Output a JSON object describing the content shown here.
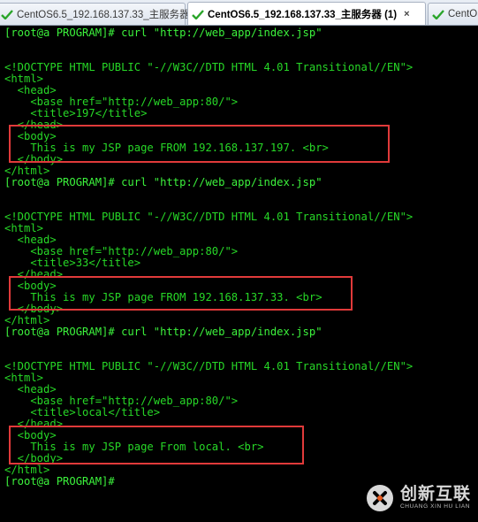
{
  "tabs": [
    {
      "label": "CentOS6.5_192.168.137.33_主服务器",
      "active": false
    },
    {
      "label": "CentOS6.5_192.168.137.33_主服务器 (1)",
      "active": true,
      "close": "×"
    },
    {
      "label": "CentOS",
      "active": false
    }
  ],
  "terminal": {
    "lines": [
      "[root@a PROGRAM]# curl \"http://web_app/index.jsp\"",
      "",
      "",
      "<!DOCTYPE HTML PUBLIC \"-//W3C//DTD HTML 4.01 Transitional//EN\">",
      "<html>",
      "  <head>",
      "    <base href=\"http://web_app:80/\">",
      "    <title>197</title>",
      "  </head>",
      "  <body>",
      "    This is my JSP page FROM 192.168.137.197. <br>",
      "  </body>",
      "</html>",
      "[root@a PROGRAM]# curl \"http://web_app/index.jsp\"",
      "",
      "",
      "<!DOCTYPE HTML PUBLIC \"-//W3C//DTD HTML 4.01 Transitional//EN\">",
      "<html>",
      "  <head>",
      "    <base href=\"http://web_app:80/\">",
      "    <title>33</title>",
      "  </head>",
      "  <body>",
      "    This is my JSP page FROM 192.168.137.33. <br>",
      "  </body>",
      "</html>",
      "[root@a PROGRAM]# curl \"http://web_app/index.jsp\"",
      "",
      "",
      "<!DOCTYPE HTML PUBLIC \"-//W3C//DTD HTML 4.01 Transitional//EN\">",
      "<html>",
      "  <head>",
      "    <base href=\"http://web_app:80/\">",
      "    <title>local</title>",
      "  </head>",
      "  <body>",
      "    This is my JSP page From local. <br>",
      "  </body>",
      "</html>",
      "[root@a PROGRAM]#"
    ]
  },
  "colors": {
    "terminal_bg": "#000000",
    "terminal_fg": "#27d827",
    "highlight_box": "#e03a3a"
  },
  "watermark": {
    "title": "创新互联",
    "subtitle": "CHUANG XIN HU LIAN"
  }
}
